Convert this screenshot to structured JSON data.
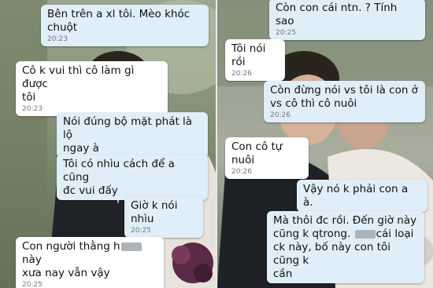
{
  "left": {
    "messages": [
      {
        "side": "out",
        "text": "Bên trên a xl tôi. Mèo khóc\nchuột",
        "time": "20:23"
      },
      {
        "side": "in",
        "text": "Cô k vui thì cô làm gì được\ntôi",
        "time": "20:23"
      },
      {
        "side": "out",
        "text": "Nói đúng bộ mặt phát là lộ\nngay à",
        "time": ""
      },
      {
        "side": "out",
        "text": "Tôi có nhìu cách để a cũng\nđc vui đấy",
        "time": ""
      },
      {
        "side": "out",
        "text": "Giờ k nói nhìu",
        "time": "20:25"
      },
      {
        "side": "in",
        "text_a": "Con người thằng h",
        "text_b": "này\nxưa nay vẫn vậy",
        "time": "20:25"
      }
    ]
  },
  "right": {
    "messages": [
      {
        "side": "out",
        "text": "Còn con cái ntn. ? Tính sao",
        "time": "20:25"
      },
      {
        "side": "in",
        "text": "Tôi nói rồi",
        "time": "20:26"
      },
      {
        "side": "out",
        "text": "Còn đừng nói vs tôi là con ở\nvs cô thì cô nuôi",
        "time": "20:26"
      },
      {
        "side": "in",
        "text": "Con cô tự nuôi",
        "time": "20:26"
      },
      {
        "side": "out",
        "text": "Vậy nó k phải con a à.",
        "time": ""
      },
      {
        "side": "out",
        "text_a": "Mà thôi đc rồi. Đến giờ này\ncũng k qtrong. ",
        "text_b": "cái loại\nck này, bố này con tôi cũng k\ncần",
        "time": ""
      }
    ]
  }
}
